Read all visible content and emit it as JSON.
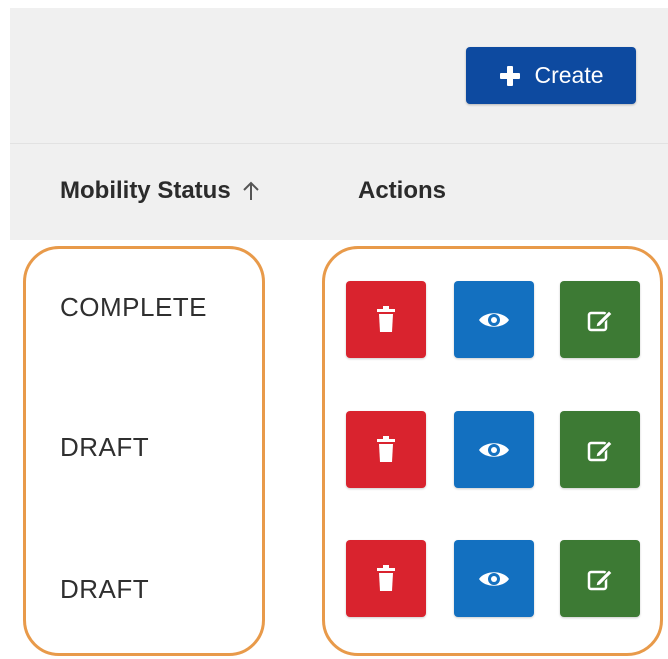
{
  "toolbar": {
    "create_label": "Create",
    "create_icon": "plus-icon"
  },
  "table": {
    "columns": [
      {
        "label": "Mobility Status",
        "sorted": "ascending",
        "sort_icon": "arrow-up-icon"
      },
      {
        "label": "Actions"
      }
    ],
    "rows": [
      {
        "status": "COMPLETE"
      },
      {
        "status": "DRAFT"
      },
      {
        "status": "DRAFT"
      }
    ],
    "row_actions": [
      {
        "name": "delete",
        "icon": "trash-icon",
        "color": "#d9232e"
      },
      {
        "name": "view",
        "icon": "eye-icon",
        "color": "#1370c0"
      },
      {
        "name": "edit",
        "icon": "edit-icon",
        "color": "#3d7a34"
      }
    ]
  },
  "colors": {
    "primary": "#0d4aa0",
    "highlight": "#e89a4a",
    "header_bg": "#f0f0f0"
  }
}
